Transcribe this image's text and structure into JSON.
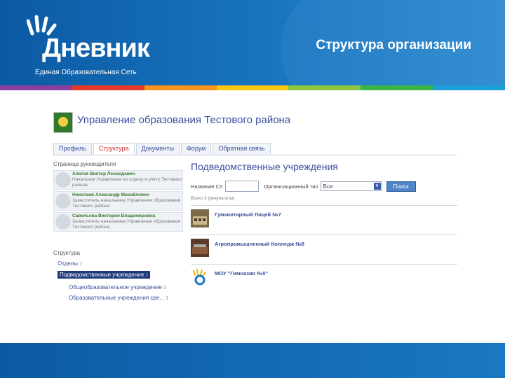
{
  "header": {
    "logo_word": "Дневник",
    "logo_tagline": "Единая Образовательная Сеть",
    "slide_title": "Структура организации"
  },
  "stripe_colors": [
    "#8a3fa0",
    "#e63a2b",
    "#f7941d",
    "#f9c80e",
    "#8dc63f",
    "#39b54a",
    "#1ba0d8"
  ],
  "org": {
    "title": "Управление образования Тестового района"
  },
  "tabs": [
    "Профиль",
    "Структура",
    "Документы",
    "Форум",
    "Обратная связь"
  ],
  "active_tab_index": 1,
  "left": {
    "leaders_heading": "Страница руководителя",
    "people": [
      {
        "name": "Апатов Виктор Леонидович",
        "desc": "Начальник Управления по отделу и учёту Тестового района"
      },
      {
        "name": "Николаев Александр Михайлович",
        "desc": "Заместитель начальника Управления образования Тестового района"
      },
      {
        "name": "Савельева Виктория Владимировна",
        "desc": "Заместитель начальника Управления образования Тестового района"
      }
    ],
    "structure_heading": "Структура",
    "structure_items": [
      {
        "label": "Отделы",
        "count": "7"
      },
      {
        "label": "Подведомственные учреждения",
        "count": "3"
      },
      {
        "label": "Общеобразовательное учреждение",
        "count": "2"
      },
      {
        "label": "Образовательные учреждения сре...",
        "count": "1"
      }
    ]
  },
  "right": {
    "title": "Подведомственные учреждения",
    "name_label": "Название СУ",
    "type_label": "Организационный тип",
    "type_value": "Все",
    "search_button": "Поиск",
    "count_text": "Всего 3 (результаты)",
    "results": [
      {
        "name": "Гуманитарный Лицей №7"
      },
      {
        "name": "Агропромышленный Колледж №8"
      },
      {
        "name": "МОУ \"Гимназия №0\""
      }
    ]
  }
}
